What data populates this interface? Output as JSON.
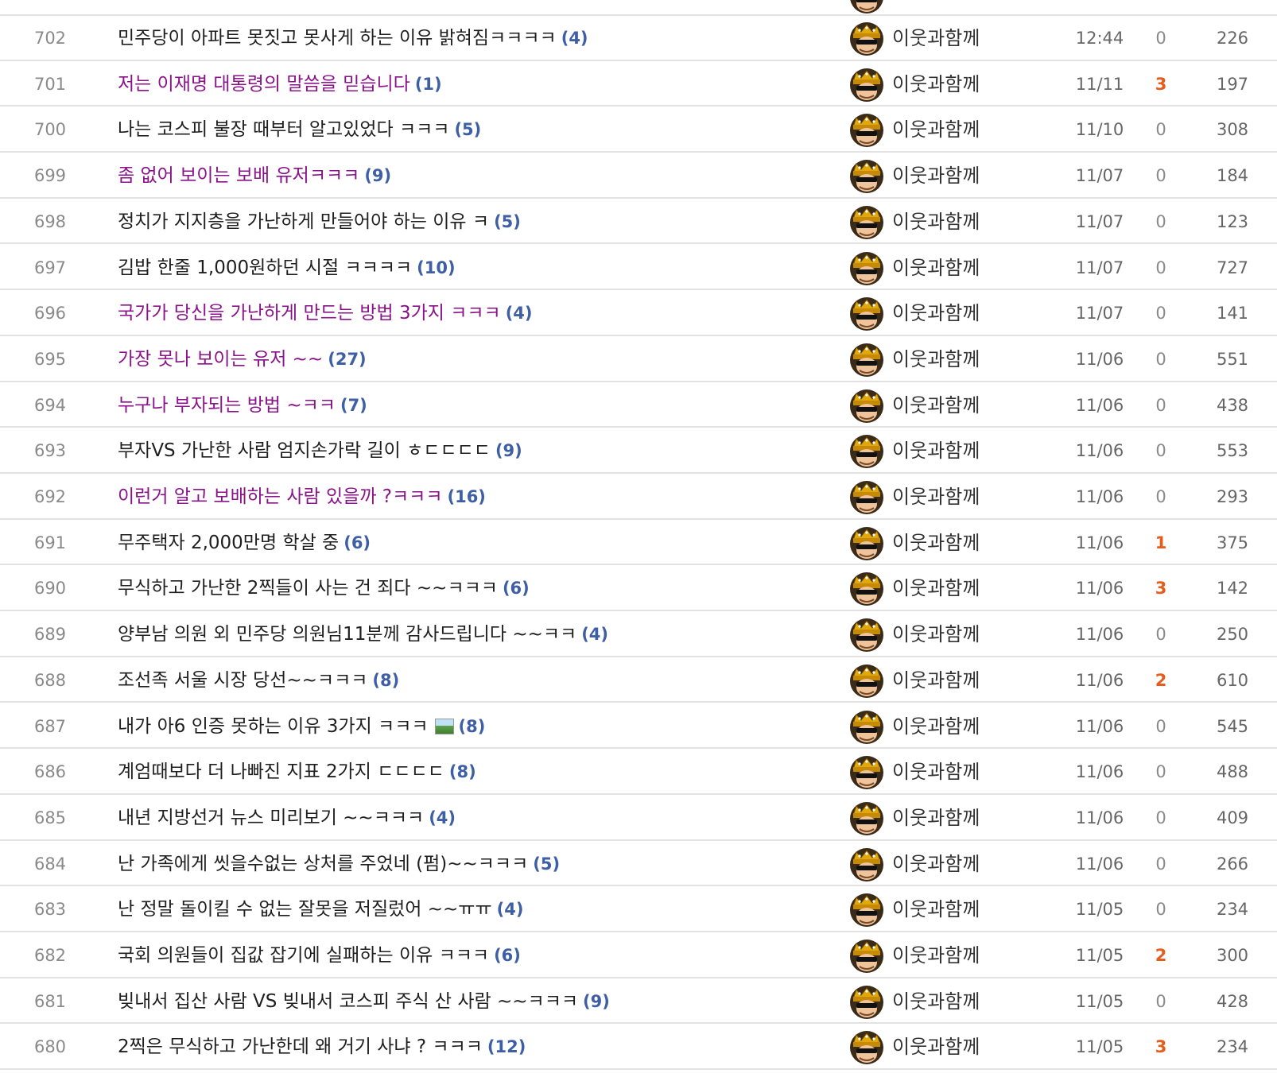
{
  "posts": [
    {
      "num": "702",
      "title": "민주당이 아파트 못짓고 못사게 하는 이유 밝혀짐ㅋㅋㅋㅋ",
      "comments": "(4)",
      "visited": false,
      "image": false,
      "writer": "이웃과함께",
      "date": "12:44",
      "recommend": "0",
      "hits": "226"
    },
    {
      "num": "701",
      "title": "저는 이재명 대통령의 말씀을 믿습니다",
      "comments": "(1)",
      "visited": true,
      "image": false,
      "writer": "이웃과함께",
      "date": "11/11",
      "recommend": "3",
      "hits": "197"
    },
    {
      "num": "700",
      "title": "나는 코스피 불장 때부터 알고있었다 ㅋㅋㅋ",
      "comments": "(5)",
      "visited": false,
      "image": false,
      "writer": "이웃과함께",
      "date": "11/10",
      "recommend": "0",
      "hits": "308"
    },
    {
      "num": "699",
      "title": "좀 없어 보이는 보배 유저ㅋㅋㅋ",
      "comments": "(9)",
      "visited": true,
      "image": false,
      "writer": "이웃과함께",
      "date": "11/07",
      "recommend": "0",
      "hits": "184"
    },
    {
      "num": "698",
      "title": "정치가 지지층을 가난하게 만들어야 하는 이유 ㅋ",
      "comments": "(5)",
      "visited": false,
      "image": false,
      "writer": "이웃과함께",
      "date": "11/07",
      "recommend": "0",
      "hits": "123"
    },
    {
      "num": "697",
      "title": "김밥 한줄 1,000원하던 시절 ㅋㅋㅋㅋ",
      "comments": "(10)",
      "visited": false,
      "image": false,
      "writer": "이웃과함께",
      "date": "11/07",
      "recommend": "0",
      "hits": "727"
    },
    {
      "num": "696",
      "title": "국가가 당신을 가난하게 만드는 방법 3가지 ㅋㅋㅋ",
      "comments": "(4)",
      "visited": true,
      "image": false,
      "writer": "이웃과함께",
      "date": "11/07",
      "recommend": "0",
      "hits": "141"
    },
    {
      "num": "695",
      "title": "가장 못나 보이는 유저 ~~",
      "comments": "(27)",
      "visited": true,
      "image": false,
      "writer": "이웃과함께",
      "date": "11/06",
      "recommend": "0",
      "hits": "551"
    },
    {
      "num": "694",
      "title": "누구나 부자되는 방법 ~ㅋㅋ",
      "comments": "(7)",
      "visited": true,
      "image": false,
      "writer": "이웃과함께",
      "date": "11/06",
      "recommend": "0",
      "hits": "438"
    },
    {
      "num": "693",
      "title": "부자VS 가난한 사람 엄지손가락 길이 ㅎㄷㄷㄷㄷ",
      "comments": "(9)",
      "visited": false,
      "image": false,
      "writer": "이웃과함께",
      "date": "11/06",
      "recommend": "0",
      "hits": "553"
    },
    {
      "num": "692",
      "title": "이런거 알고 보배하는 사람 있을까 ?ㅋㅋㅋ",
      "comments": "(16)",
      "visited": true,
      "image": false,
      "writer": "이웃과함께",
      "date": "11/06",
      "recommend": "0",
      "hits": "293"
    },
    {
      "num": "691",
      "title": "무주택자 2,000만명 학살 중",
      "comments": "(6)",
      "visited": false,
      "image": false,
      "writer": "이웃과함께",
      "date": "11/06",
      "recommend": "1",
      "hits": "375"
    },
    {
      "num": "690",
      "title": "무식하고 가난한 2찍들이 사는 건 죄다 ~~ㅋㅋㅋ",
      "comments": "(6)",
      "visited": false,
      "image": false,
      "writer": "이웃과함께",
      "date": "11/06",
      "recommend": "3",
      "hits": "142"
    },
    {
      "num": "689",
      "title": "양부남 의원 외 민주당 의원님11분께 감사드립니다 ~~ㅋㅋ",
      "comments": "(4)",
      "visited": false,
      "image": false,
      "writer": "이웃과함께",
      "date": "11/06",
      "recommend": "0",
      "hits": "250"
    },
    {
      "num": "688",
      "title": "조선족 서울 시장 당선~~ㅋㅋㅋ",
      "comments": "(8)",
      "visited": false,
      "image": false,
      "writer": "이웃과함께",
      "date": "11/06",
      "recommend": "2",
      "hits": "610"
    },
    {
      "num": "687",
      "title": "내가 아6 인증 못하는 이유 3가지 ㅋㅋㅋ",
      "comments": "(8)",
      "visited": false,
      "image": true,
      "writer": "이웃과함께",
      "date": "11/06",
      "recommend": "0",
      "hits": "545"
    },
    {
      "num": "686",
      "title": "계엄때보다 더 나빠진 지표 2가지 ㄷㄷㄷㄷ",
      "comments": "(8)",
      "visited": false,
      "image": false,
      "writer": "이웃과함께",
      "date": "11/06",
      "recommend": "0",
      "hits": "488"
    },
    {
      "num": "685",
      "title": "내년 지방선거 뉴스 미리보기 ~~ㅋㅋㅋ",
      "comments": "(4)",
      "visited": false,
      "image": false,
      "writer": "이웃과함께",
      "date": "11/06",
      "recommend": "0",
      "hits": "409"
    },
    {
      "num": "684",
      "title": "난 가족에게 씻을수없는 상처를 주었네 (펌)~~ㅋㅋㅋ",
      "comments": "(5)",
      "visited": false,
      "image": false,
      "writer": "이웃과함께",
      "date": "11/06",
      "recommend": "0",
      "hits": "266"
    },
    {
      "num": "683",
      "title": "난 정말 돌이킬 수 없는 잘못을 저질렀어 ~~ㅠㅠ",
      "comments": "(4)",
      "visited": false,
      "image": false,
      "writer": "이웃과함께",
      "date": "11/05",
      "recommend": "0",
      "hits": "234"
    },
    {
      "num": "682",
      "title": "국회 의원들이 집값 잡기에 실패하는 이유 ㅋㅋㅋ",
      "comments": "(6)",
      "visited": false,
      "image": false,
      "writer": "이웃과함께",
      "date": "11/05",
      "recommend": "2",
      "hits": "300"
    },
    {
      "num": "681",
      "title": "빚내서 집산 사람 VS 빚내서 코스피 주식 산 사람 ~~ㅋㅋㅋ",
      "comments": "(9)",
      "visited": false,
      "image": false,
      "writer": "이웃과함께",
      "date": "11/05",
      "recommend": "0",
      "hits": "428"
    },
    {
      "num": "680",
      "title": "2찍은 무식하고 가난한데 왜 거기 사냐 ? ㅋㅋㅋ",
      "comments": "(12)",
      "visited": false,
      "image": false,
      "writer": "이웃과함께",
      "date": "11/05",
      "recommend": "3",
      "hits": "234"
    }
  ],
  "colors": {
    "visited_title": "#8a138a",
    "comment_count": "#3e5fa6",
    "recommend_hot": "#e65c1a",
    "divider": "#e2e2e2"
  },
  "icons": {
    "avatar": "avatar-icon",
    "image_attachment": "image-attachment-icon"
  }
}
